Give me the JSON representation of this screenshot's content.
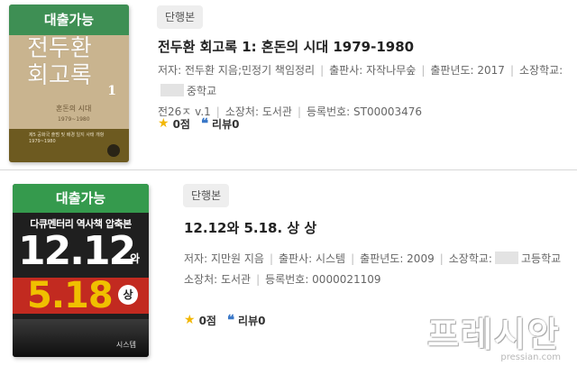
{
  "items": [
    {
      "cover": {
        "ribbon": "대출가능",
        "title_lines": [
          "전두환",
          "회고록"
        ],
        "volume": "1",
        "subtitle": "혼돈의 시대",
        "years": "1979~1980",
        "blurb": "제5 공화국 출범 및 배경 일지 사태 개항 1979~1980"
      },
      "tag": "단행본",
      "title": "전두환 회고록 1: 혼돈의 시대 1979-1980",
      "meta_line1": {
        "author": "저자: 전두환 지음;민정기 책임정리",
        "publisher": "출판사: 자작나무숲",
        "year": "출판년도: 2017",
        "school_prefix": "소장학교:",
        "school_suffix": "중학교"
      },
      "meta_line2": {
        "call_number": "전26ㅈ v.1",
        "location": "소장처: 도서관",
        "reg_number": "등록번호: ST00003476"
      },
      "rating": "0점",
      "reviews": "리뷰0"
    },
    {
      "cover": {
        "ribbon": "대출가능",
        "series": "다큐멘터리 역사책 압축본",
        "big_text": "12.12",
        "wa": "와",
        "red_text": "5.18",
        "sang": "상",
        "publisher": "시스템"
      },
      "tag": "단행본",
      "title": "12.12와 5.18. 상 상",
      "meta_line1": {
        "author": "저자: 지만원 지음",
        "publisher": "출판사: 시스템",
        "year": "출판년도: 2009",
        "school_prefix": "소장학교:",
        "school_suffix": "고등학교"
      },
      "meta_line2": {
        "location": "소장처: 도서관",
        "reg_number": "등록번호: 0000021109"
      },
      "rating": "0점",
      "reviews": "리뷰0"
    }
  ],
  "watermark": {
    "main": "프레시안",
    "url": "pressian.com"
  },
  "icons": {
    "star_color": "#f2b705",
    "quote_color": "#3a78c8"
  }
}
